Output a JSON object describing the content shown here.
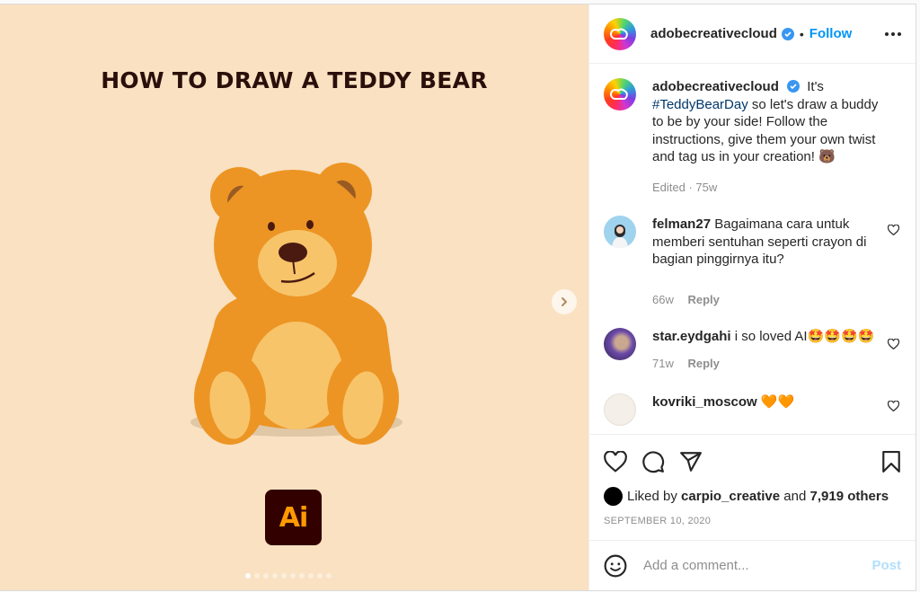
{
  "media": {
    "title": "HOW TO DRAW A TEDDY BEAR",
    "app_badge": "Ai",
    "carousel": {
      "total_slides": 10,
      "active_index": 0
    },
    "colors": {
      "background": "#f9e1c1",
      "bear_fur": "#ec9524",
      "bear_light": "#f7c46a",
      "ai_bg": "#330000",
      "ai_text": "#ff9a00"
    }
  },
  "header": {
    "username": "adobecreativecloud",
    "verified": true,
    "separator": "•",
    "follow_label": "Follow",
    "more_icon": "more-horizontal-icon"
  },
  "caption": {
    "username": "adobecreativecloud",
    "text_before": "It's",
    "hashtag": "#TeddyBearDay",
    "text_after": "so let's draw a buddy to be by your side! Follow the instructions, give them your own twist and tag us in your creation! 🐻",
    "meta": "Edited · 75w"
  },
  "comments": [
    {
      "username": "felman27",
      "text": "Bagaimana cara untuk memberi sentuhan seperti crayon di bagian pinggirnya itu?",
      "age": "66w",
      "reply_label": "Reply"
    },
    {
      "username": "star.eydgahi",
      "text": "i so loved AI🤩🤩🤩🤩",
      "age": "71w",
      "reply_label": "Reply"
    },
    {
      "username": "kovriki_moscow",
      "text": "🧡🧡",
      "age": "",
      "reply_label": ""
    }
  ],
  "actions": {
    "icons": [
      "heart-icon",
      "comment-icon",
      "share-icon",
      "bookmark-icon"
    ],
    "likes_prefix": "Liked by",
    "likes_user": "carpio_creative",
    "likes_mid": "and",
    "likes_count": "7,919 others",
    "date": "SEPTEMBER 10, 2020"
  },
  "add_comment": {
    "placeholder": "Add a comment...",
    "post_label": "Post",
    "emoji_icon": "smiley-icon"
  },
  "colors": {
    "link_blue": "#0095f6",
    "hashtag": "#00376b",
    "muted": "#8e8e8e",
    "post_disabled": "#b2dffc"
  }
}
